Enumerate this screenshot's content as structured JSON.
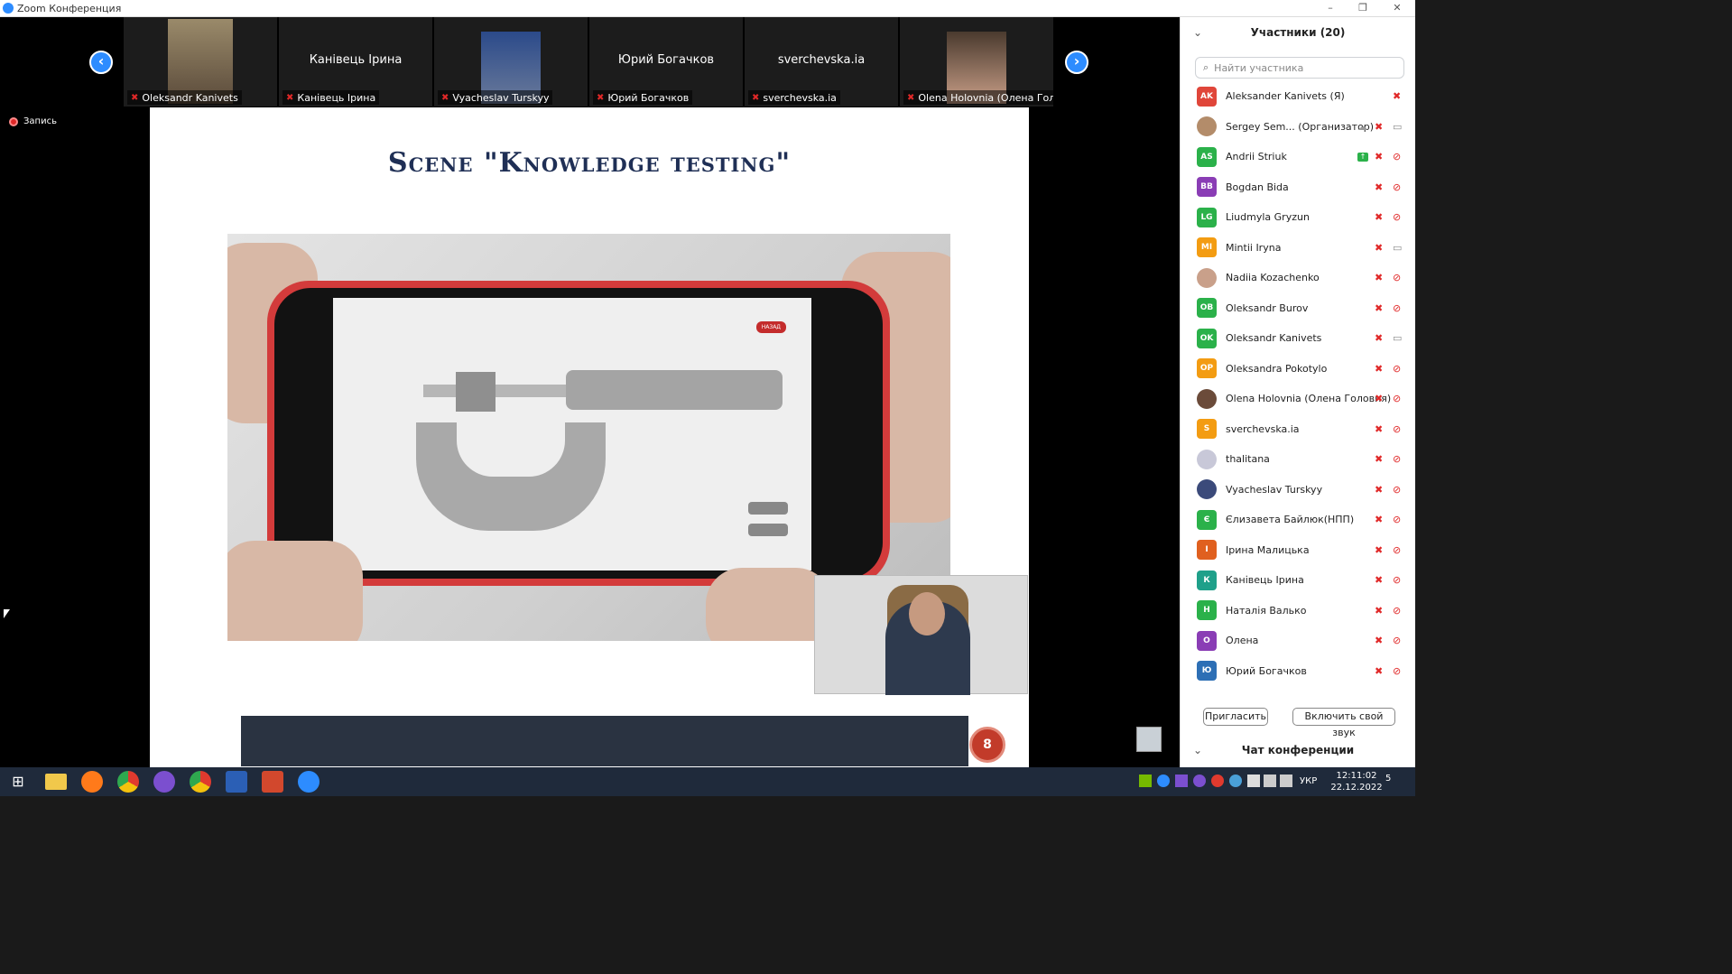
{
  "window": {
    "title": "Zoom Конференция",
    "minimize": "–",
    "restore": "❐",
    "close": "✕"
  },
  "gallery": {
    "prev_icon": "‹",
    "next_icon": "›",
    "tiles": [
      {
        "name": "Oleksandr Kanivets",
        "big": "",
        "photo": true
      },
      {
        "name": "Канівець Ірина",
        "big": "Канівець Ірина",
        "photo": false
      },
      {
        "name": "Vyacheslav Turskyy",
        "big": "",
        "photo": true
      },
      {
        "name": "Юрий Богачков",
        "big": "Юрий Богачков",
        "photo": false
      },
      {
        "name": "sverchevska.ia",
        "big": "sverchevska.ia",
        "photo": false
      },
      {
        "name": "Olena Holovnia (Олена Гол...",
        "big": "",
        "photo": true
      }
    ]
  },
  "recording": {
    "label": "Запись"
  },
  "slide": {
    "heading": "Scene \"Knowledge testing\"",
    "phone_back_button": "НАЗАД",
    "page_number": "8"
  },
  "participants": {
    "title": "Участники (20)",
    "search_placeholder": "Найти участника",
    "list": [
      {
        "initials": "AK",
        "color": "#e0463a",
        "name": "Aleksander Kanivets (Я)",
        "mic": true,
        "cam": "none"
      },
      {
        "initials": "",
        "color": "#b38c6a",
        "name": "Sergey Sem...  (Организатор)",
        "mic": true,
        "cam": "on",
        "cloud": true
      },
      {
        "initials": "AS",
        "color": "#2bb14a",
        "name": "Andrii Striuk",
        "mic": true,
        "cam": "off",
        "share": true
      },
      {
        "initials": "BB",
        "color": "#8a3db5",
        "name": "Bogdan Bida",
        "mic": true,
        "cam": "off"
      },
      {
        "initials": "LG",
        "color": "#2bb14a",
        "name": "Liudmyla Gryzun",
        "mic": true,
        "cam": "off"
      },
      {
        "initials": "MI",
        "color": "#f39c12",
        "name": "Mintii Iryna",
        "mic": true,
        "cam": "on"
      },
      {
        "initials": "",
        "color": "#c9a08a",
        "name": "Nadiia Kozachenko",
        "mic": true,
        "cam": "off"
      },
      {
        "initials": "OB",
        "color": "#2bb14a",
        "name": "Oleksandr Burov",
        "mic": true,
        "cam": "off"
      },
      {
        "initials": "OK",
        "color": "#2bb14a",
        "name": "Oleksandr Kanivets",
        "mic": true,
        "cam": "on"
      },
      {
        "initials": "OP",
        "color": "#f39c12",
        "name": "Oleksandra Pokotylo",
        "mic": true,
        "cam": "off"
      },
      {
        "initials": "",
        "color": "#6b4b3a",
        "name": "Olena Holovnia (Олена Головня)",
        "mic": true,
        "cam": "off"
      },
      {
        "initials": "S",
        "color": "#f39c12",
        "name": "sverchevska.ia",
        "mic": true,
        "cam": "off"
      },
      {
        "initials": "",
        "color": "#c8c8d8",
        "name": "thalitana",
        "mic": true,
        "cam": "off"
      },
      {
        "initials": "",
        "color": "#3b4a7a",
        "name": "Vyacheslav Turskyy",
        "mic": true,
        "cam": "off"
      },
      {
        "initials": "Є",
        "color": "#2bb14a",
        "name": "Єлизавета Байлюк(НПП)",
        "mic": true,
        "cam": "off"
      },
      {
        "initials": "І",
        "color": "#e0601f",
        "name": "Ірина Малицька",
        "mic": true,
        "cam": "off"
      },
      {
        "initials": "К",
        "color": "#1fa08a",
        "name": "Канівець Ірина",
        "mic": true,
        "cam": "off"
      },
      {
        "initials": "Н",
        "color": "#2bb14a",
        "name": "Наталія Валько",
        "mic": true,
        "cam": "off"
      },
      {
        "initials": "О",
        "color": "#8a3db5",
        "name": "Олена",
        "mic": true,
        "cam": "off"
      },
      {
        "initials": "Ю",
        "color": "#2d6fb5",
        "name": "Юрий Богачков",
        "mic": true,
        "cam": "off"
      }
    ],
    "invite_button": "Пригласить",
    "unmute_button": "Включить свой звук"
  },
  "chat": {
    "title": "Чат конференции"
  },
  "taskbar": {
    "apps": [
      "windows-start-icon",
      "file-explorer-icon",
      "firefox-icon",
      "chrome-icon",
      "viber-icon",
      "chrome-alt-icon",
      "word-icon",
      "powerpoint-icon",
      "zoom-icon"
    ],
    "language": "УКР",
    "time": "12:11:02",
    "date": "22.12.2022",
    "notifications": "5"
  }
}
